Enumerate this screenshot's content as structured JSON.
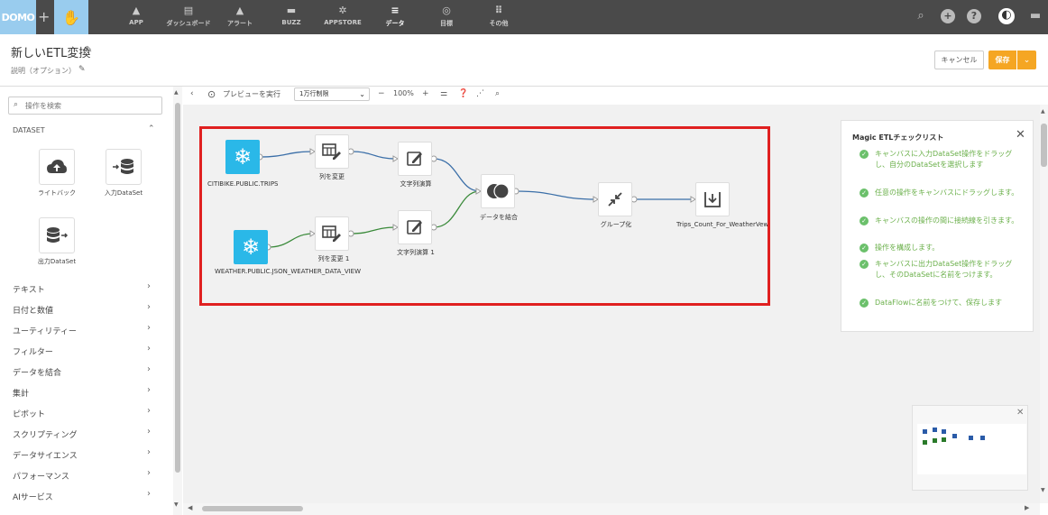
{
  "topnav": {
    "logo": "DOMO",
    "items": [
      {
        "label": "APP",
        "icon": "rocket-icon"
      },
      {
        "label": "ダッシュボード",
        "icon": "dashboard-icon"
      },
      {
        "label": "アラート",
        "icon": "bell-icon"
      },
      {
        "label": "BUZZ",
        "icon": "chat-icon"
      },
      {
        "label": "APPSTORE",
        "icon": "appstore-icon"
      },
      {
        "label": "データ",
        "icon": "database-icon"
      },
      {
        "label": "目標",
        "icon": "target-icon"
      },
      {
        "label": "その他",
        "icon": "grid-icon"
      }
    ],
    "active": "データ",
    "right_icons": [
      "search-icon",
      "plus-circle-icon",
      "help-icon",
      "avatar",
      "messages-icon"
    ]
  },
  "header": {
    "title": "新しいETL変換",
    "description_placeholder": "説明（オプション）",
    "cancel_label": "キャンセル",
    "save_label": "保存"
  },
  "sidebar": {
    "search_placeholder": "操作を検索",
    "dataset_header": "DATASET",
    "dataset_tiles": [
      {
        "label": "ライトバック",
        "icon": "cloud-upload-icon"
      },
      {
        "label": "入力DataSet",
        "icon": "input-dataset-icon"
      },
      {
        "label": "出力DataSet",
        "icon": "output-dataset-icon"
      }
    ],
    "categories": [
      "テキスト",
      "日付と数値",
      "ユーティリティー",
      "フィルター",
      "データを結合",
      "集計",
      "ピボット",
      "スクリプティング",
      "データサイエンス",
      "パフォーマンス",
      "AIサービス"
    ]
  },
  "toolbar": {
    "preview_label": "プレビューを実行",
    "row_limit": "1万行制限",
    "zoom": "100%"
  },
  "flow": {
    "nodes": {
      "input1": "CITIBIKE.PUBLIC.TRIPS",
      "select1": "列を変更",
      "formula1": "文字列演算",
      "input2": "WEATHER.PUBLIC.JSON_WEATHER_DATA_VIEW",
      "select2": "列を変更 1",
      "formula2": "文字列演算 1",
      "join": "データを結合",
      "group": "グループ化",
      "output": "Trips_Count_For_WeatherVew"
    },
    "colors": {
      "blue_line": "#3b6fa8",
      "green_line": "#3a8a3a",
      "snowflake": "#2ab8e8",
      "highlight": "#e02020"
    }
  },
  "checklist": {
    "title": "Magic ETLチェックリスト",
    "items": [
      "キャンバスに入力DataSet操作をドラッグし、自分のDataSetを選択します",
      "任意の操作をキャンバスにドラッグします。",
      "キャンバスの操作の間に接続線を引きます。",
      "操作を構成します。",
      "キャンバスに出力DataSet操作をドラッグし、そのDataSetに名前をつけます。",
      "DataFlowに名前をつけて、保存します"
    ]
  }
}
